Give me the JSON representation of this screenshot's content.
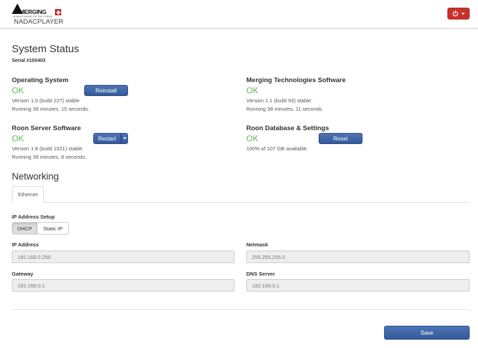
{
  "header": {
    "brand": "MERGING",
    "brand_tagline": "ALWAYS AHEAD OF THE CURVE",
    "product": "NADACPLAYER",
    "power_icon": "power-icon",
    "accent": "#c9302c"
  },
  "status": {
    "title": "System Status",
    "serial": "Serial #100403",
    "os": {
      "title": "Operating System",
      "state": "OK",
      "version": "Version 1.0 (build 227) stable",
      "running": "Running 38 minutes, 15 seconds.",
      "button": "Reinstall"
    },
    "merging": {
      "title": "Merging Technologies Software",
      "state": "OK",
      "version": "Version 1.1 (build 93) stable.",
      "running": "Running 38 minutes, 11 seconds."
    },
    "roon_server": {
      "title": "Roon Server Software",
      "state": "OK",
      "version": "Version 1.8 (build 1021) stable",
      "running": "Running 38 minutes, 8 seconds.",
      "button": "Restart"
    },
    "roon_db": {
      "title": "Roon Database & Settings",
      "state": "OK",
      "usage": "100% of 107 GB available.",
      "button": "Reset"
    }
  },
  "networking": {
    "title": "Networking",
    "tab": "Ethernet",
    "ip_setup_label": "IP Address Setup",
    "options": [
      "DHCP",
      "Static IP"
    ],
    "selected": "DHCP",
    "ip_label": "IP Address",
    "ip_value": "192.168.0.250",
    "netmask_label": "Netmask",
    "netmask_value": "255.255.255.0",
    "gateway_label": "Gateway",
    "gateway_value": "192.168.0.1",
    "dns_label": "DNS Server",
    "dns_value": "192.168.0.1"
  },
  "footer": {
    "save": "Save"
  },
  "colors": {
    "ok": "#5cb85c",
    "primary": "#3b62a5",
    "danger": "#c9302c"
  }
}
